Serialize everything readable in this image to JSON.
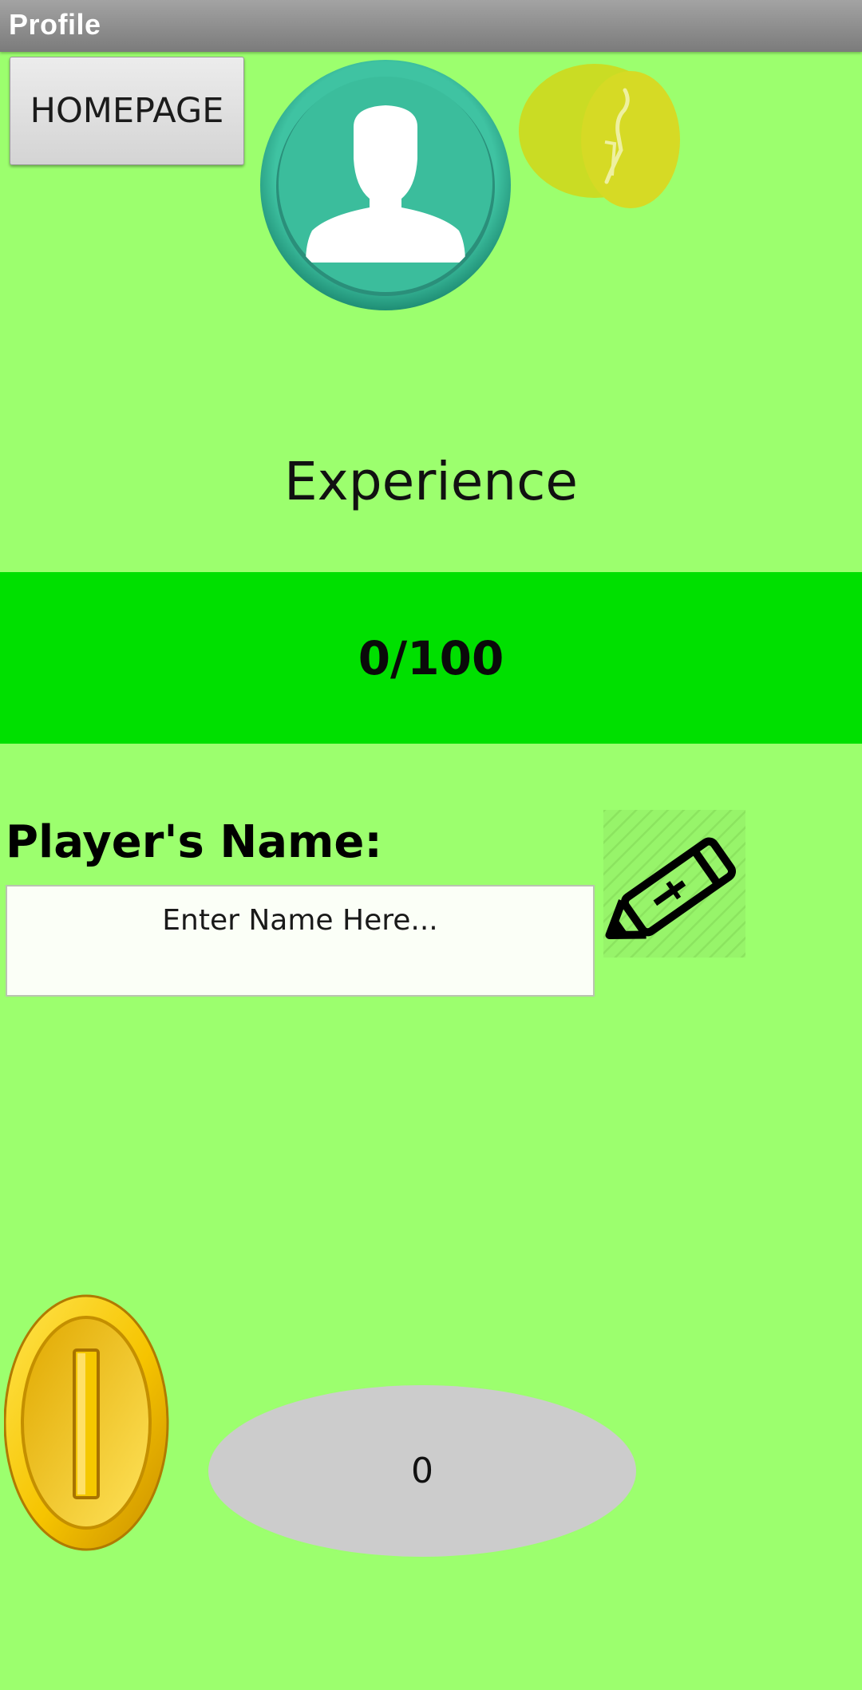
{
  "window": {
    "title": "Profile"
  },
  "header": {
    "home_button_label": "HOMEPAGE",
    "avatar_icon": "person-avatar-icon",
    "badge_icon": "yellow-badge-icon"
  },
  "experience": {
    "label": "Experience",
    "progress_text": "0/100",
    "current": 0,
    "max": 100,
    "bar_color": "#00e000"
  },
  "player": {
    "name_label": "Player's Name:",
    "name_input_value": "",
    "name_input_placeholder": "Enter Name Here...",
    "edit_icon": "pencil-icon"
  },
  "coins": {
    "icon": "gold-coin-icon",
    "count": "0"
  },
  "colors": {
    "background": "#9cff6e",
    "accent_green": "#00e000",
    "avatar_teal": "#3bbd9c",
    "coin_gold": "#f2c200"
  }
}
